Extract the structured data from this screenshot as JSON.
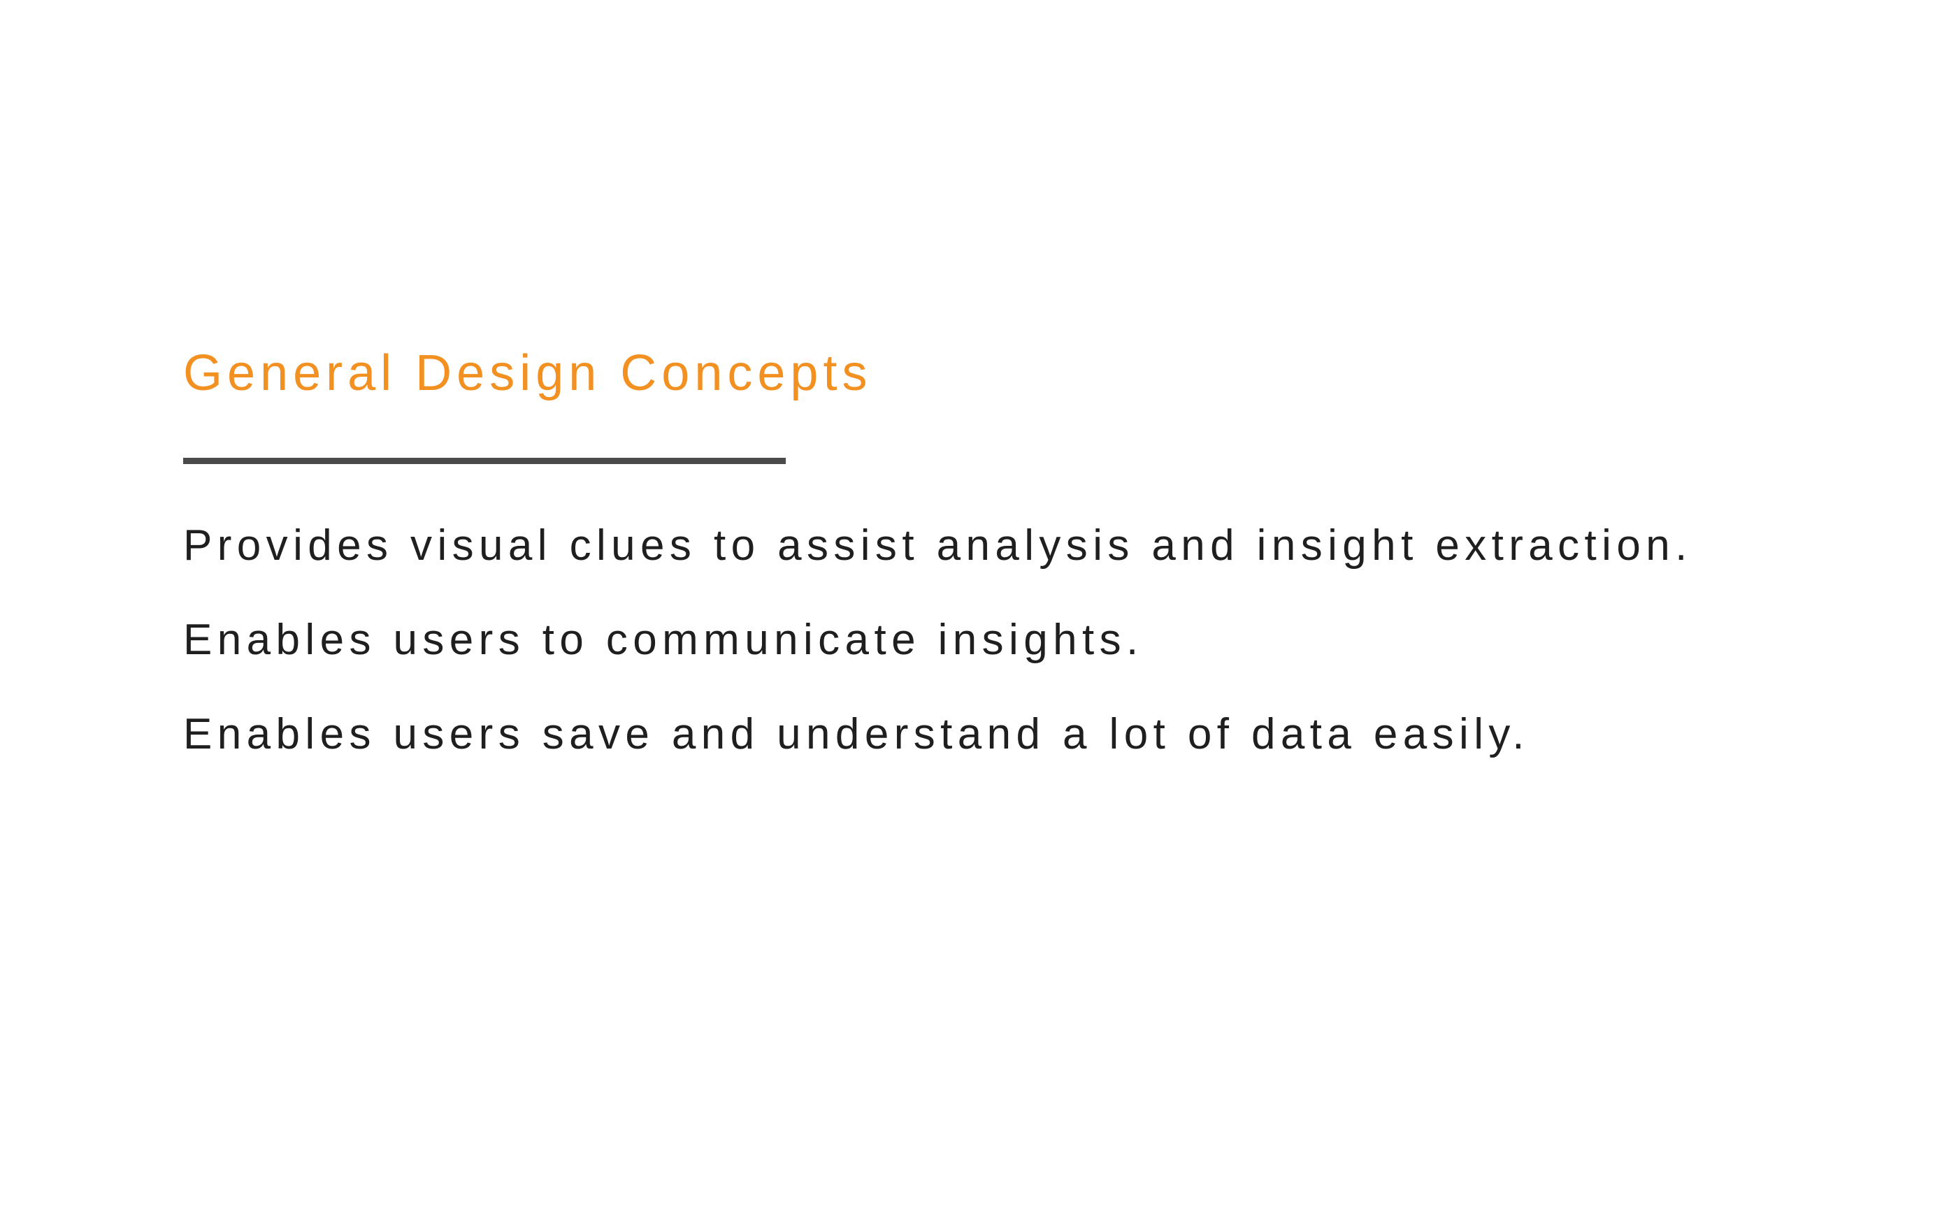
{
  "slide": {
    "title": "General Design Concepts",
    "points": [
      "Provides visual clues to assist analysis and insight extraction.",
      "Enables users to communicate insights.",
      "Enables users save and understand a lot of data easily."
    ]
  },
  "colors": {
    "title": "#F29022",
    "rule": "#4a4a4a",
    "body_text": "#1f1f1f",
    "background": "#ffffff"
  }
}
